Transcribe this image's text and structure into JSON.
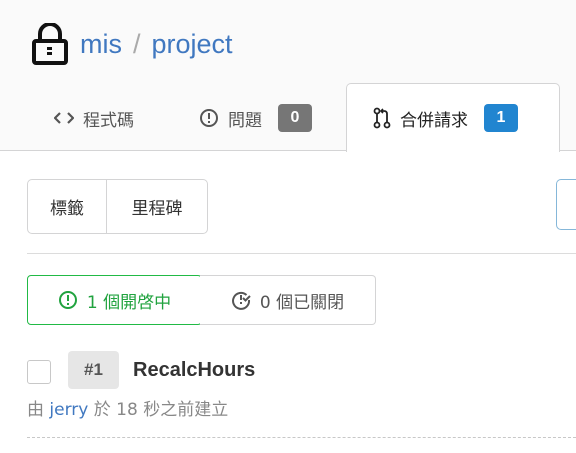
{
  "repo": {
    "owner": "mis",
    "separator": "/",
    "name": "project"
  },
  "tabs": {
    "code": {
      "label": "程式碼",
      "icon": "code-icon"
    },
    "issues": {
      "label": "問題",
      "count": "0",
      "icon": "issue-opened-icon"
    },
    "pulls": {
      "label": "合併請求",
      "count": "1",
      "icon": "git-pull-request-icon"
    }
  },
  "filters": {
    "labels": "標籤",
    "milestones": "里程碑"
  },
  "state": {
    "open": "1 個開啓中",
    "closed": "0 個已關閉"
  },
  "pull_requests": [
    {
      "number": "#1",
      "title": "RecalcHours",
      "meta_prefix": "由",
      "author": "jerry",
      "meta_suffix": "於 18 秒之前建立"
    }
  ],
  "colors": {
    "link": "#4078c0",
    "open_green": "#21ba45",
    "badge_grey": "#767676",
    "badge_blue": "#2185d0"
  }
}
